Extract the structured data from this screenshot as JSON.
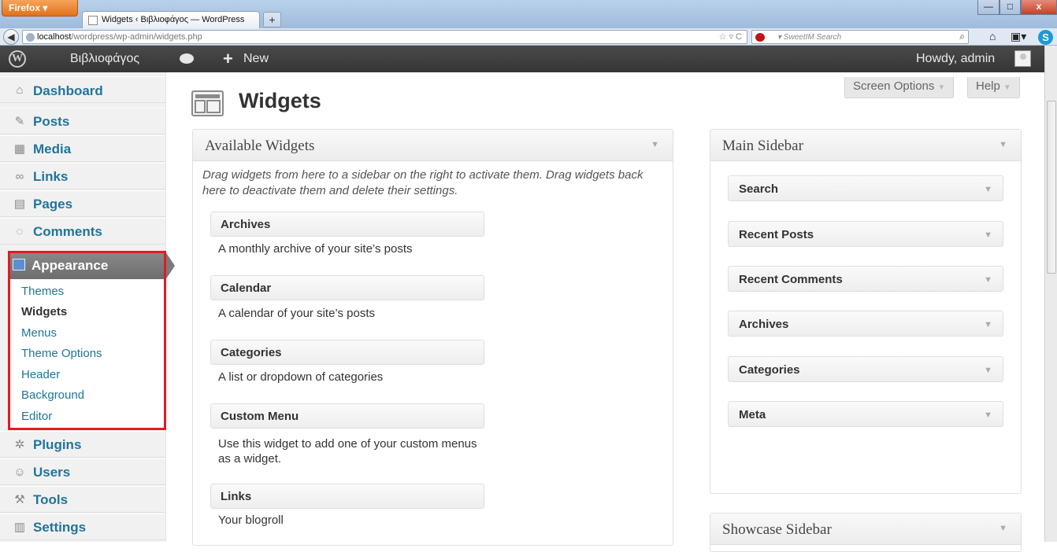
{
  "browser": {
    "menu_button": "Firefox ▾",
    "tab_title": "Widgets ‹ Βιβλιοφάγος — WordPress",
    "new_tab": "+",
    "url_host": "localhost",
    "url_path": "/wordpress/wp-admin/widgets.php",
    "url_icons": "☆ ▿ C",
    "search_placeholder": "▾ SweetIM Search",
    "search_icon": "⌕",
    "minimize": "—",
    "maximize": "□",
    "close": "x",
    "home_icon": "⌂",
    "bookmark_icon": "▣▾",
    "skype_letter": "S",
    "back_icon": "◀"
  },
  "adminbar": {
    "logo": "W",
    "site_name": "Βιβλιοφάγος",
    "new_plus": "+",
    "new_label": "New",
    "howdy": "Howdy, admin"
  },
  "menu": {
    "items": [
      {
        "label": "Dashboard",
        "icon": "⌂"
      },
      {
        "label": "Posts",
        "icon": "✎"
      },
      {
        "label": "Media",
        "icon": "▦"
      },
      {
        "label": "Links",
        "icon": "∞"
      },
      {
        "label": "Pages",
        "icon": "▤"
      },
      {
        "label": "Comments",
        "icon": "◌"
      },
      {
        "label": "Plugins",
        "icon": "✲"
      },
      {
        "label": "Users",
        "icon": "☺"
      },
      {
        "label": "Tools",
        "icon": "⚒"
      },
      {
        "label": "Settings",
        "icon": "▥"
      }
    ],
    "appearance": {
      "label": "Appearance",
      "sub": [
        "Themes",
        "Widgets",
        "Menus",
        "Theme Options",
        "Header",
        "Background",
        "Editor"
      ]
    }
  },
  "header": {
    "title": "Widgets",
    "screen_options": "Screen Options",
    "help": "Help",
    "arrow": "▼"
  },
  "available": {
    "title": "Available Widgets",
    "description": "Drag widgets from here to a sidebar on the right to activate them. Drag widgets back here to deactivate them and delete their settings.",
    "widgets": [
      {
        "name": "Archives",
        "desc": "A monthly archive of your site’s posts"
      },
      {
        "name": "Calendar",
        "desc": "A calendar of your site’s posts"
      },
      {
        "name": "Categories",
        "desc": "A list or dropdown of categories"
      },
      {
        "name": "Custom Menu",
        "desc": "Use this widget to add one of your custom menus as a widget."
      },
      {
        "name": "Links",
        "desc": "Your blogroll"
      }
    ]
  },
  "main_sidebar": {
    "title": "Main Sidebar",
    "widgets": [
      "Search",
      "Recent Posts",
      "Recent Comments",
      "Archives",
      "Categories",
      "Meta"
    ]
  },
  "showcase_sidebar": {
    "title": "Showcase Sidebar"
  },
  "colors": {
    "link": "#21759b",
    "highlight": "#e11b22",
    "adminbar": "#464646"
  }
}
